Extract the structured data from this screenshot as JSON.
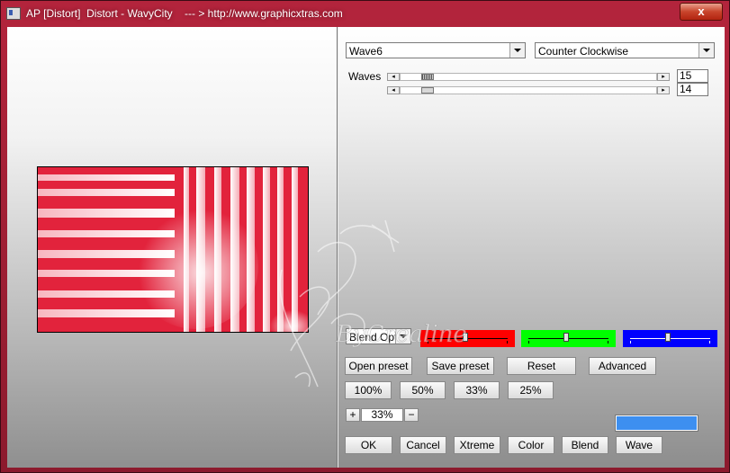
{
  "window": {
    "title": "AP [Distort]  Distort - WavyCity    --- > http://www.graphicxtras.com",
    "close_label": "x"
  },
  "controls": {
    "preset_select": "Wave6",
    "direction_select": "Counter Clockwise",
    "waves_label": "Waves",
    "slider1_value": "15",
    "slider2_value": "14",
    "blend_select": "Blend Optio",
    "buttons": {
      "open_preset": "Open preset",
      "save_preset": "Save preset",
      "reset": "Reset",
      "advanced": "Advanced",
      "zoom100": "100%",
      "zoom50": "50%",
      "zoom33": "33%",
      "zoom25": "25%",
      "zoom_plus": "+",
      "zoom_value": "33%",
      "zoom_minus": "−",
      "ok": "OK",
      "cancel": "Cancel",
      "xtreme": "Xtreme",
      "color": "Color",
      "blend": "Blend",
      "wave": "Wave"
    }
  },
  "colors": {
    "red_channel": "#ff0000",
    "green_channel": "#00ff00",
    "blue_channel": "#0000ff",
    "swatch": "#3d8ff0"
  },
  "watermark_text": "ByCrealine"
}
